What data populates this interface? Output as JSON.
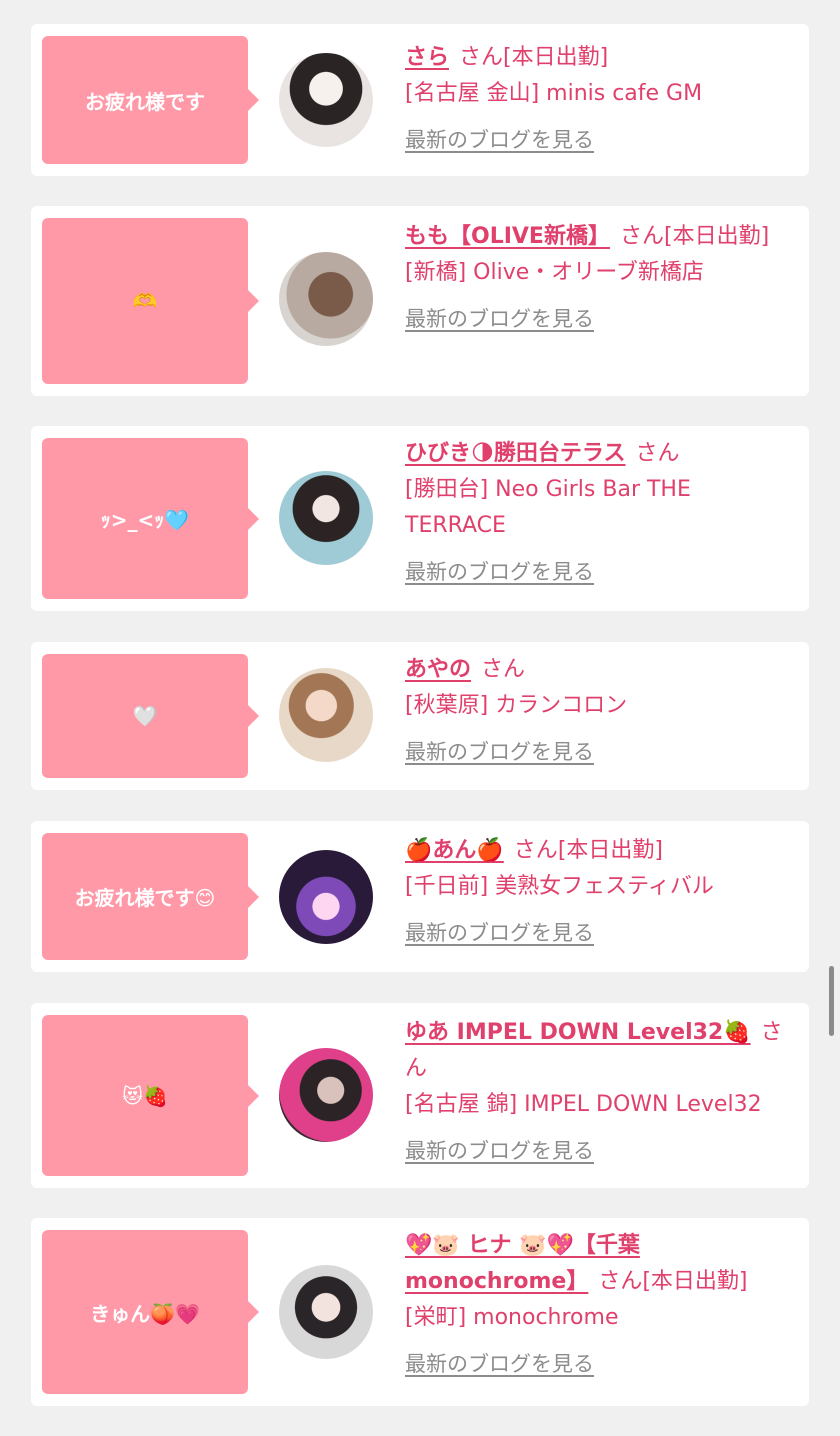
{
  "blog_link_label": "最新のブログを見る",
  "cards": [
    {
      "bubble": "お疲れ様です",
      "name": "さら",
      "san": "さん",
      "status": "[本日出勤]",
      "shop": "[名古屋 金山] minis cafe GM"
    },
    {
      "bubble": "🫶",
      "name": "もも【OLIVE新橋】",
      "san": "さん",
      "status": "[本日出勤]",
      "shop": "[新橋] Olive・オリーブ新橋店"
    },
    {
      "bubble": "ｯ>_<ｯ🩵",
      "name": "ひびき🌗勝田台テラス",
      "san": "さん",
      "status": "",
      "shop": "[勝田台] Neo Girls Bar THE TERRACE"
    },
    {
      "bubble": "🤍",
      "name": "あやの",
      "san": "さん",
      "status": "",
      "shop": "[秋葉原] カランコロン"
    },
    {
      "bubble": "お疲れ様です😊",
      "name": "🍎あん🍎",
      "san": "さん",
      "status": "[本日出勤]",
      "shop": "[千日前] 美熟女フェスティバル"
    },
    {
      "bubble": "😻🍓",
      "name": "ゆあ IMPEL DOWN Level32🍓",
      "san": "さん",
      "status": "",
      "shop": "[名古屋 錦] IMPEL DOWN Level32"
    },
    {
      "bubble": "きゅん🍑💗",
      "name": "💖🐷 ヒナ 🐷💖【千葉monochrome】",
      "san": "さん",
      "status": "[本日出勤]",
      "shop": "[栄町] monochrome"
    }
  ]
}
